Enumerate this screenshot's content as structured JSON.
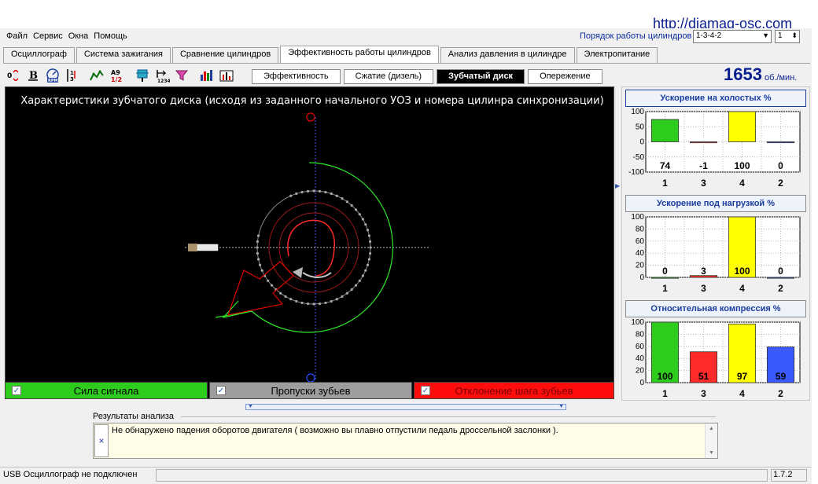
{
  "watermark": "http://diamag-osc.com",
  "menu": [
    "Файл",
    "Сервис",
    "Окна",
    "Помощь"
  ],
  "cylinder_order": {
    "label": "Порядок работы цилиндров",
    "value": "1-3-4-2",
    "cylinder": "1"
  },
  "main_tabs": [
    {
      "label": "Осциллограф",
      "active": false
    },
    {
      "label": "Система зажигания",
      "active": false
    },
    {
      "label": "Сравнение цилиндров",
      "active": false
    },
    {
      "label": "Эффективность работы цилиндров",
      "active": true
    },
    {
      "label": "Анализ давления в цилиндре",
      "active": false
    },
    {
      "label": "Электропитание",
      "active": false
    }
  ],
  "toolbar": [
    "sliders-icon",
    "bold-icon",
    "rpm-icon",
    "scale-icon",
    "wave-icon",
    "fraction-icon",
    "cylinder-icon",
    "counter-icon",
    "filter-icon",
    "bars-icon",
    "chart-icon"
  ],
  "sub_tabs": [
    {
      "label": "Эффективность",
      "active": false
    },
    {
      "label": "Сжатие (дизель)",
      "active": false
    },
    {
      "label": "Зубчатый диск",
      "active": true
    },
    {
      "label": "Опережение",
      "active": false
    }
  ],
  "rpm": {
    "value": "1653",
    "unit": "об./мин."
  },
  "scope": {
    "title": "Характеристики зубчатого диска (исходя из заданного начального УОЗ и номера цилинра синхронизации)"
  },
  "legend": [
    {
      "label": "Сила сигнала",
      "checked": true,
      "color": "#2ecc1c"
    },
    {
      "label": "Пропуски зубьев",
      "checked": true,
      "color": "#9d9d9d"
    },
    {
      "label": "Отклонение шага зубьев",
      "checked": true,
      "color": "#ff0d0d"
    }
  ],
  "chart_data": [
    {
      "type": "bar",
      "title": "Ускорение на холостых %",
      "categories": [
        "1",
        "3",
        "4",
        "2"
      ],
      "values": [
        74,
        -1,
        100,
        0
      ],
      "colors": [
        "#2ecc1c",
        "#ff2a2a",
        "#ffff00",
        "#3a5aff"
      ],
      "ylim": [
        -100,
        100
      ],
      "yticks": [
        100,
        50,
        0,
        -50,
        -100
      ],
      "grid": true
    },
    {
      "type": "bar",
      "title": "Ускорение под нагрузкой %",
      "categories": [
        "1",
        "3",
        "4",
        "2"
      ],
      "values": [
        0,
        3,
        100,
        0
      ],
      "colors": [
        "#2ecc1c",
        "#ff2a2a",
        "#ffff00",
        "#3a5aff"
      ],
      "ylim": [
        0,
        100
      ],
      "yticks": [
        100,
        80,
        60,
        40,
        20,
        0
      ],
      "grid": true
    },
    {
      "type": "bar",
      "title": "Относительная компрессия %",
      "categories": [
        "1",
        "3",
        "4",
        "2"
      ],
      "values": [
        100,
        51,
        97,
        59
      ],
      "colors": [
        "#2ecc1c",
        "#ff2a2a",
        "#ffff00",
        "#3a5aff"
      ],
      "ylim": [
        0,
        100
      ],
      "yticks": [
        100,
        80,
        60,
        40,
        20,
        0
      ],
      "grid": true
    }
  ],
  "results": {
    "label": "Результаты анализа",
    "close": "×",
    "text": "Не обнаружено падения оборотов двигателя ( возможно вы плавно отпустили педаль дроссельной заслонки )."
  },
  "status": {
    "left": "USB Осциллограф не подключен",
    "version": "1.7.2"
  }
}
